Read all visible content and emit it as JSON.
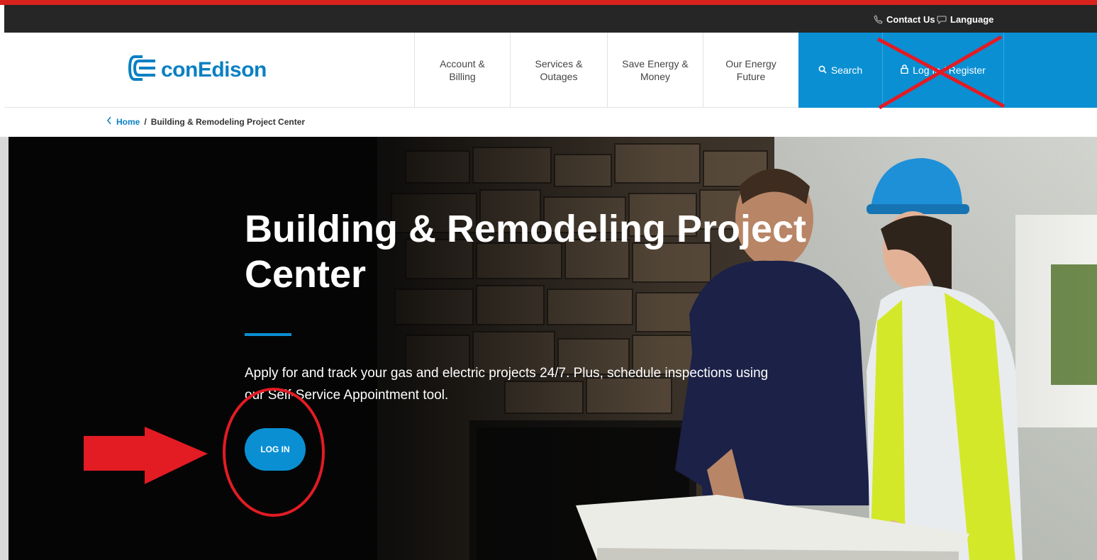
{
  "utility": {
    "contact_label": "Contact Us",
    "language_label": "Language"
  },
  "header": {
    "logo_text": "conEdison",
    "nav": [
      {
        "line1": "Account &",
        "line2": "Billing"
      },
      {
        "line1": "Services &",
        "line2": "Outages"
      },
      {
        "line1": "Save Energy &",
        "line2": "Money"
      },
      {
        "line1": "Our Energy",
        "line2": "Future"
      }
    ],
    "search_label": "Search",
    "login_label": "Log In / Register"
  },
  "breadcrumb": {
    "home": "Home",
    "separator": "/",
    "current": "Building & Remodeling Project Center"
  },
  "hero": {
    "title": "Building & Remodeling Project Center",
    "description": "Apply for and track your gas and electric projects 24/7. Plus, schedule inspections using our Self-Service Appointment tool.",
    "button_label": "LOG IN"
  },
  "icons": {
    "contact": "phone-icon",
    "language": "chat-bubble-icon",
    "search": "magnifier-icon",
    "login": "lock-icon",
    "breadcrumb_back": "chevron-left-icon"
  },
  "colors": {
    "brand_blue": "#0a8fd3",
    "logo_blue": "#0a80c3",
    "annotation_red": "#e31b23",
    "utility_bar": "#262626"
  }
}
